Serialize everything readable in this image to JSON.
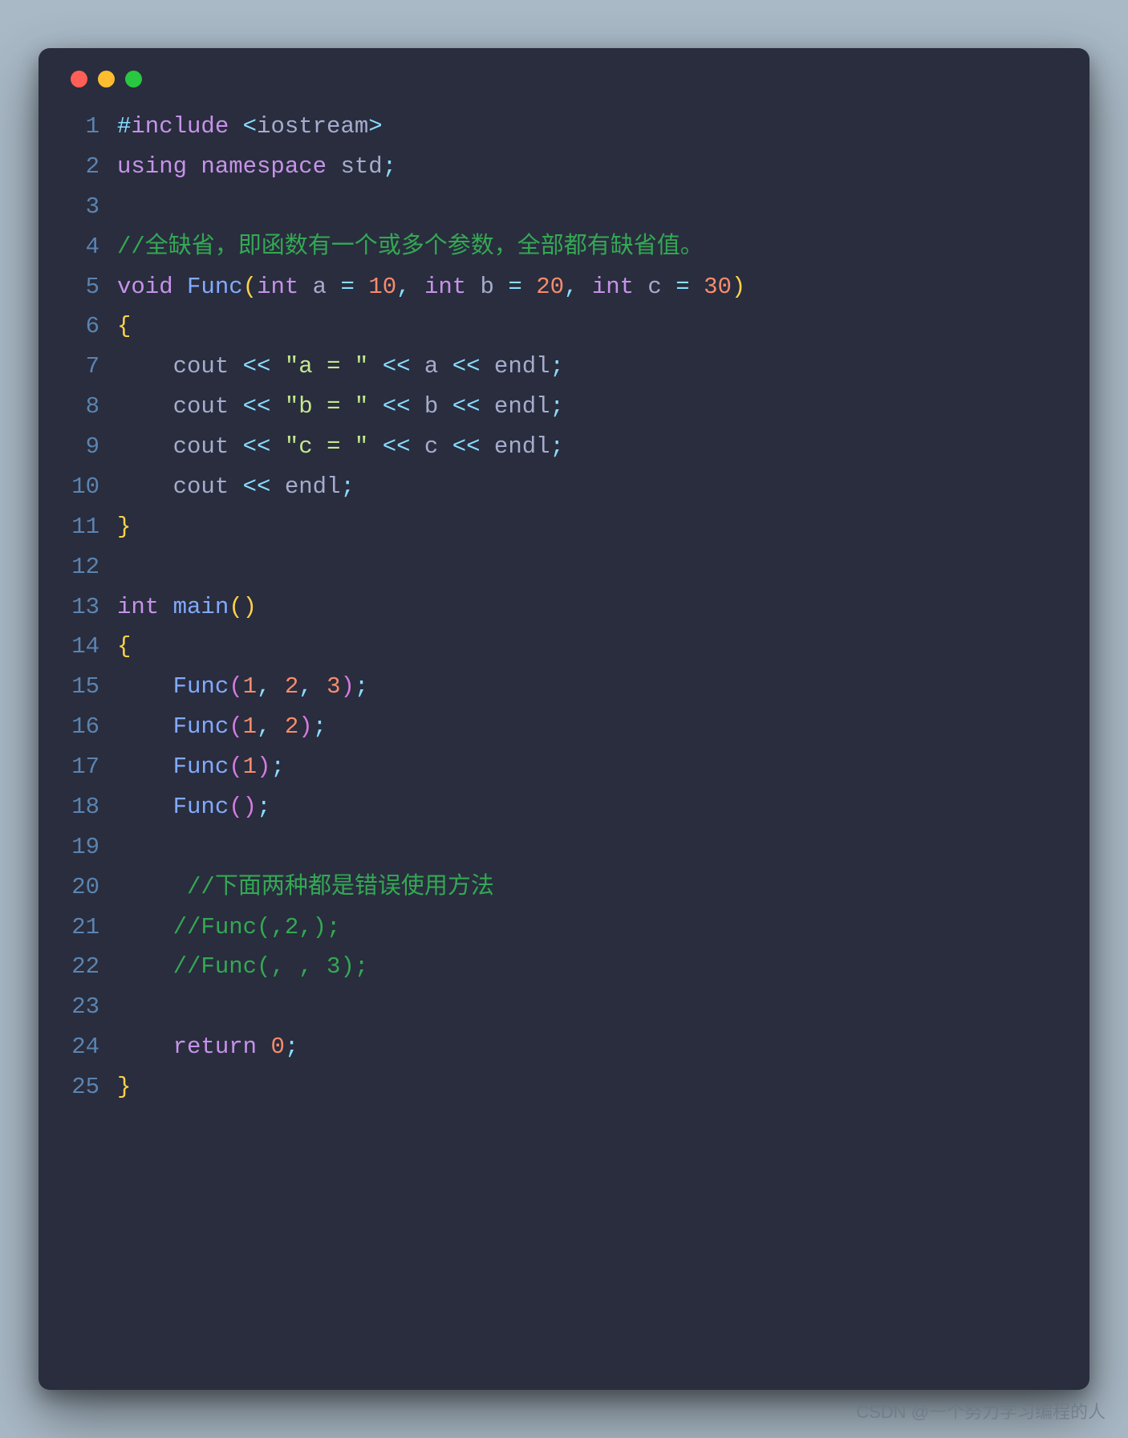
{
  "titlebar": {
    "close": "close",
    "minimize": "minimize",
    "maximize": "maximize"
  },
  "colors": {
    "background": "#292d3e",
    "keyword": "#c792ea",
    "function": "#82aaff",
    "operator": "#89ddff",
    "string": "#c3e88d",
    "number": "#f78c6c",
    "comment": "#34a853",
    "identifier": "#a6accd",
    "bracket1": "#ffd24a",
    "bracket2": "#d57bdf",
    "lineNumber": "#5b84b1"
  },
  "watermark": "CSDN @一个努力学习编程的人",
  "lines": [
    {
      "n": "1",
      "tokens": [
        [
          "pp",
          "#"
        ],
        [
          "ppk",
          "include"
        ],
        [
          "id",
          " "
        ],
        [
          "op",
          "<"
        ],
        [
          "id",
          "iostream"
        ],
        [
          "op",
          ">"
        ]
      ]
    },
    {
      "n": "2",
      "tokens": [
        [
          "k",
          "using"
        ],
        [
          "id",
          " "
        ],
        [
          "k",
          "namespace"
        ],
        [
          "id",
          " std"
        ],
        [
          "op",
          ";"
        ]
      ]
    },
    {
      "n": "3",
      "tokens": []
    },
    {
      "n": "4",
      "tokens": [
        [
          "c",
          "//全缺省，即函数有一个或多个参数，全部都有缺省值。"
        ]
      ]
    },
    {
      "n": "5",
      "tokens": [
        [
          "t",
          "void"
        ],
        [
          "id",
          " "
        ],
        [
          "fn",
          "Func"
        ],
        [
          "br",
          "("
        ],
        [
          "t",
          "int"
        ],
        [
          "id",
          " a "
        ],
        [
          "op",
          "="
        ],
        [
          "id",
          " "
        ],
        [
          "n",
          "10"
        ],
        [
          "op",
          ","
        ],
        [
          "id",
          " "
        ],
        [
          "t",
          "int"
        ],
        [
          "id",
          " b "
        ],
        [
          "op",
          "="
        ],
        [
          "id",
          " "
        ],
        [
          "n",
          "20"
        ],
        [
          "op",
          ","
        ],
        [
          "id",
          " "
        ],
        [
          "t",
          "int"
        ],
        [
          "id",
          " c "
        ],
        [
          "op",
          "="
        ],
        [
          "id",
          " "
        ],
        [
          "n",
          "30"
        ],
        [
          "br",
          ")"
        ]
      ]
    },
    {
      "n": "6",
      "tokens": [
        [
          "br",
          "{"
        ]
      ]
    },
    {
      "n": "7",
      "tokens": [
        [
          "id",
          "    cout "
        ],
        [
          "op",
          "<<"
        ],
        [
          "id",
          " "
        ],
        [
          "s",
          "\"a = \""
        ],
        [
          "id",
          " "
        ],
        [
          "op",
          "<<"
        ],
        [
          "id",
          " a "
        ],
        [
          "op",
          "<<"
        ],
        [
          "id",
          " endl"
        ],
        [
          "op",
          ";"
        ]
      ]
    },
    {
      "n": "8",
      "tokens": [
        [
          "id",
          "    cout "
        ],
        [
          "op",
          "<<"
        ],
        [
          "id",
          " "
        ],
        [
          "s",
          "\"b = \""
        ],
        [
          "id",
          " "
        ],
        [
          "op",
          "<<"
        ],
        [
          "id",
          " b "
        ],
        [
          "op",
          "<<"
        ],
        [
          "id",
          " endl"
        ],
        [
          "op",
          ";"
        ]
      ]
    },
    {
      "n": "9",
      "tokens": [
        [
          "id",
          "    cout "
        ],
        [
          "op",
          "<<"
        ],
        [
          "id",
          " "
        ],
        [
          "s",
          "\"c = \""
        ],
        [
          "id",
          " "
        ],
        [
          "op",
          "<<"
        ],
        [
          "id",
          " c "
        ],
        [
          "op",
          "<<"
        ],
        [
          "id",
          " endl"
        ],
        [
          "op",
          ";"
        ]
      ]
    },
    {
      "n": "10",
      "tokens": [
        [
          "id",
          "    cout "
        ],
        [
          "op",
          "<<"
        ],
        [
          "id",
          " endl"
        ],
        [
          "op",
          ";"
        ]
      ]
    },
    {
      "n": "11",
      "tokens": [
        [
          "br",
          "}"
        ]
      ]
    },
    {
      "n": "12",
      "tokens": []
    },
    {
      "n": "13",
      "tokens": [
        [
          "t",
          "int"
        ],
        [
          "id",
          " "
        ],
        [
          "fn",
          "main"
        ],
        [
          "br",
          "()"
        ]
      ]
    },
    {
      "n": "14",
      "tokens": [
        [
          "br",
          "{"
        ]
      ]
    },
    {
      "n": "15",
      "tokens": [
        [
          "id",
          "    "
        ],
        [
          "fn",
          "Func"
        ],
        [
          "br2",
          "("
        ],
        [
          "n",
          "1"
        ],
        [
          "op",
          ","
        ],
        [
          "id",
          " "
        ],
        [
          "n",
          "2"
        ],
        [
          "op",
          ","
        ],
        [
          "id",
          " "
        ],
        [
          "n",
          "3"
        ],
        [
          "br2",
          ")"
        ],
        [
          "op",
          ";"
        ]
      ]
    },
    {
      "n": "16",
      "tokens": [
        [
          "id",
          "    "
        ],
        [
          "fn",
          "Func"
        ],
        [
          "br2",
          "("
        ],
        [
          "n",
          "1"
        ],
        [
          "op",
          ","
        ],
        [
          "id",
          " "
        ],
        [
          "n",
          "2"
        ],
        [
          "br2",
          ")"
        ],
        [
          "op",
          ";"
        ]
      ]
    },
    {
      "n": "17",
      "tokens": [
        [
          "id",
          "    "
        ],
        [
          "fn",
          "Func"
        ],
        [
          "br2",
          "("
        ],
        [
          "n",
          "1"
        ],
        [
          "br2",
          ")"
        ],
        [
          "op",
          ";"
        ]
      ]
    },
    {
      "n": "18",
      "tokens": [
        [
          "id",
          "    "
        ],
        [
          "fn",
          "Func"
        ],
        [
          "br2",
          "()"
        ],
        [
          "op",
          ";"
        ]
      ]
    },
    {
      "n": "19",
      "tokens": []
    },
    {
      "n": "20",
      "tokens": [
        [
          "id",
          "     "
        ],
        [
          "c",
          "//下面两种都是错误使用方法"
        ]
      ]
    },
    {
      "n": "21",
      "tokens": [
        [
          "id",
          "    "
        ],
        [
          "c",
          "//Func(,2,);"
        ]
      ]
    },
    {
      "n": "22",
      "tokens": [
        [
          "id",
          "    "
        ],
        [
          "c",
          "//Func(, , 3);"
        ]
      ]
    },
    {
      "n": "23",
      "tokens": []
    },
    {
      "n": "24",
      "tokens": [
        [
          "id",
          "    "
        ],
        [
          "k",
          "return"
        ],
        [
          "id",
          " "
        ],
        [
          "n",
          "0"
        ],
        [
          "op",
          ";"
        ]
      ]
    },
    {
      "n": "25",
      "tokens": [
        [
          "br",
          "}"
        ]
      ]
    }
  ]
}
